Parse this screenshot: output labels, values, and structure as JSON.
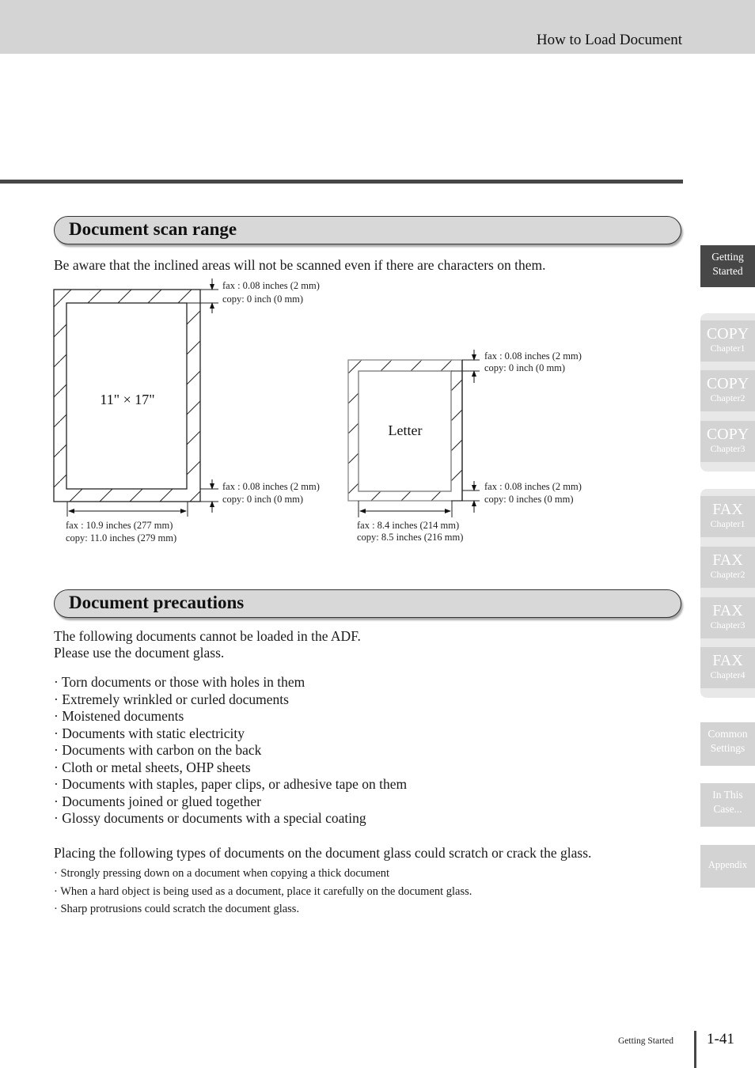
{
  "header": {
    "running_title": "How to Load Document"
  },
  "scan_range": {
    "title": "Document scan range",
    "intro": "Be aware that the inclined areas will not be scanned even if there are characters on them.",
    "ledger": {
      "label": "11\" × 17\"",
      "top_margin": {
        "fax": "fax  : 0.08 inches (2 mm)",
        "copy": "copy: 0 inch (0 mm)"
      },
      "bottom_margin": {
        "fax": "fax  : 0.08 inches (2 mm)",
        "copy": "copy: 0 inch (0 mm)"
      },
      "width": {
        "fax": "fax  : 10.9 inches (277 mm)",
        "copy": "copy: 11.0 inches (279 mm)"
      }
    },
    "letter": {
      "label": "Letter",
      "top_margin": {
        "fax": "fax  : 0.08 inches (2 mm)",
        "copy": "copy: 0 inch (0 mm)"
      },
      "bottom_margin": {
        "fax": "fax  : 0.08 inches (2 mm)",
        "copy": "copy: 0 inches (0 mm)"
      },
      "width": {
        "fax": "fax  : 8.4 inches (214 mm)",
        "copy": "copy: 8.5 inches (216 mm)"
      }
    }
  },
  "precautions": {
    "title": "Document precautions",
    "intro_line1": "The following documents cannot be loaded in the ADF.",
    "intro_line2": "Please use the document glass.",
    "adf_items": [
      "· Torn documents or those with holes in them",
      "· Extremely wrinkled or curled documents",
      "· Moistened documents",
      "· Documents with static electricity",
      "· Documents with carbon on the back",
      "· Cloth or metal sheets, OHP sheets",
      "· Documents with staples, paper clips, or adhesive tape on them",
      "· Documents joined or glued together",
      "· Glossy documents or documents with a special coating"
    ],
    "glass_intro": "Placing the following types of documents on the document glass could scratch or crack the glass.",
    "glass_items": [
      "· Strongly pressing down on a document when copying a thick document",
      "· When a hard object is being used as a document, place it carefully on the document glass.",
      "· Sharp protrusions could scratch the document glass."
    ]
  },
  "side_nav": {
    "getting_started": {
      "line1": "Getting",
      "line2": "Started"
    },
    "copy": [
      {
        "big": "COPY",
        "small": "Chapter1"
      },
      {
        "big": "COPY",
        "small": "Chapter2"
      },
      {
        "big": "COPY",
        "small": "Chapter3"
      }
    ],
    "fax": [
      {
        "big": "FAX",
        "small": "Chapter1"
      },
      {
        "big": "FAX",
        "small": "Chapter2"
      },
      {
        "big": "FAX",
        "small": "Chapter3"
      },
      {
        "big": "FAX",
        "small": "Chapter4"
      }
    ],
    "common_settings": {
      "line1": "Common",
      "line2": "Settings"
    },
    "in_this_case": {
      "line1": "In This",
      "line2": "Case..."
    },
    "appendix": {
      "label": "Appendix"
    }
  },
  "footer": {
    "section": "Getting Started",
    "page": "1-41"
  },
  "colors": {
    "band_gray": "#d4d4d4",
    "rule_dark": "#474747",
    "tab_gray": "#d3d3d3"
  }
}
